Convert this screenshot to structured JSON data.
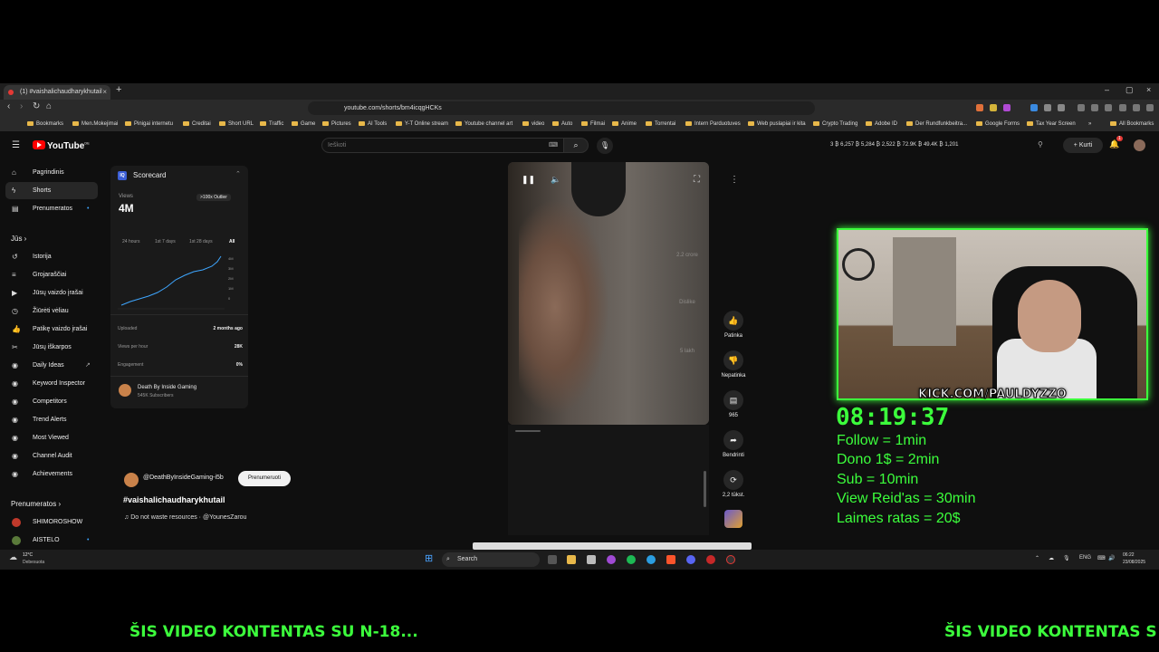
{
  "browser": {
    "tab_title": "(1) #vaishalichaudharykhutail",
    "close": "×",
    "new_tab": "+",
    "window_controls": [
      "–",
      "▢",
      "×"
    ],
    "url": "youtube.com/shorts/bm4icqgHCKs",
    "bookmarks": [
      "Bookmarks",
      "Men.Mokejimai",
      "Pinigai internetu",
      "Creditai",
      "Short URL",
      "Traffic",
      "Game",
      "Pictures",
      "AI Tools",
      "Y-T Online stream",
      "Youtube channel art",
      "video",
      "Auto",
      "Filmai",
      "Anime",
      "Torrentai",
      "Intern Parduotuves",
      "Web puslapiai ir kita",
      "Crypto Trading",
      "Adobe ID",
      "Der Rundfunkbeitra...",
      "Google Forms",
      "Tax Year Screen"
    ],
    "all_bookmarks": "All Bookmarks",
    "more": "»"
  },
  "youtube": {
    "logo": "YouTube",
    "logo_sup": "DE",
    "search_placeholder": "Ieškoti",
    "stats": "3  ₿ 6,257  ₿ 5,284  ₿ 2,522  ₿ 72.9K  ₿ 49.4K  ₿ 1,201",
    "create": "Kurti",
    "notif_count": "1"
  },
  "sidebar": {
    "top": [
      {
        "label": "Pagrindinis",
        "icon": "home-icon"
      },
      {
        "label": "Shorts",
        "icon": "shorts-icon"
      },
      {
        "label": "Prenumeratos",
        "icon": "subscriptions-icon"
      }
    ],
    "you_heading": "Jūs",
    "you": [
      {
        "label": "Istorija",
        "icon": "history-icon"
      },
      {
        "label": "Grojaraščiai",
        "icon": "playlist-icon"
      },
      {
        "label": "Jūsų vaizdo įrašai",
        "icon": "your-videos-icon"
      },
      {
        "label": "Žiūrėti vėliau",
        "icon": "watch-later-icon"
      },
      {
        "label": "Patikę vaizdo įrašai",
        "icon": "liked-icon"
      },
      {
        "label": "Jūsų iškarpos",
        "icon": "clips-icon"
      },
      {
        "label": "Daily Ideas",
        "icon": "ideas-icon"
      },
      {
        "label": "Keyword Inspector",
        "icon": "keyword-icon"
      },
      {
        "label": "Competitors",
        "icon": "competitors-icon"
      },
      {
        "label": "Trend Alerts",
        "icon": "trend-icon"
      },
      {
        "label": "Most Viewed",
        "icon": "most-viewed-icon"
      },
      {
        "label": "Channel Audit",
        "icon": "audit-icon"
      },
      {
        "label": "Achievements",
        "icon": "achievements-icon"
      }
    ],
    "subs_heading": "Prenumeratos",
    "subs": [
      {
        "label": "SHIMOROSHOW"
      },
      {
        "label": "AISTELO"
      }
    ]
  },
  "scorecard": {
    "title": "Scorecard",
    "badge": "IQ",
    "views_label": "Views",
    "views_value": "4M",
    "outlier": ">100x Outlier",
    "ranges": [
      "24 hours",
      "1st 7 days",
      "1st 28 days",
      "All"
    ],
    "y_ticks": [
      "4M",
      "3M",
      "2M",
      "1M",
      "0"
    ],
    "rows": [
      {
        "label": "Uploaded",
        "value": "2 months ago"
      },
      {
        "label": "Views per hour",
        "value": "28K"
      },
      {
        "label": "Engagement",
        "value": "0%"
      }
    ],
    "channel_name": "Death By Inside Gaming",
    "channel_subs": "545K Subscribers"
  },
  "short": {
    "channel_handle": "@DeathByInsideGaming-i5b",
    "subscribe": "Prenumeruoti",
    "title": "#vaishalichaudharykhutail",
    "music": "Do not waste resources · @YounesZarou",
    "ghost_likes": "2.2 crore",
    "ghost_dislike": "Dislike",
    "ghost_comments": "5 lakh",
    "actions": [
      {
        "label": "Patinka",
        "icon": "like-icon"
      },
      {
        "label": "Nepatinka",
        "icon": "dislike-icon"
      },
      {
        "label": "965",
        "icon": "comment-icon"
      },
      {
        "label": "Bendrinti",
        "icon": "share-icon"
      },
      {
        "label": "2,2 tūkst.",
        "icon": "remix-icon"
      }
    ]
  },
  "overlay": {
    "kick": "KICK.COM/PAULDYZZO",
    "timer": "08:19:37",
    "rules": [
      "Follow = 1min",
      "Dono 1$ = 2min",
      "Sub = 10min",
      "View Reid'as = 30min",
      "Laimes ratas = 20$"
    ],
    "marquee": "ŠIS VIDEO KONTENTAS SU N-18...",
    "marquee2": "ŠIS VIDEO KONTENTAS S"
  },
  "taskbar": {
    "weather_temp": "12°C",
    "weather_desc": "Debesuota",
    "search": "Search",
    "lang": "ENG",
    "time": "06:22",
    "date": "23/08/2025"
  }
}
